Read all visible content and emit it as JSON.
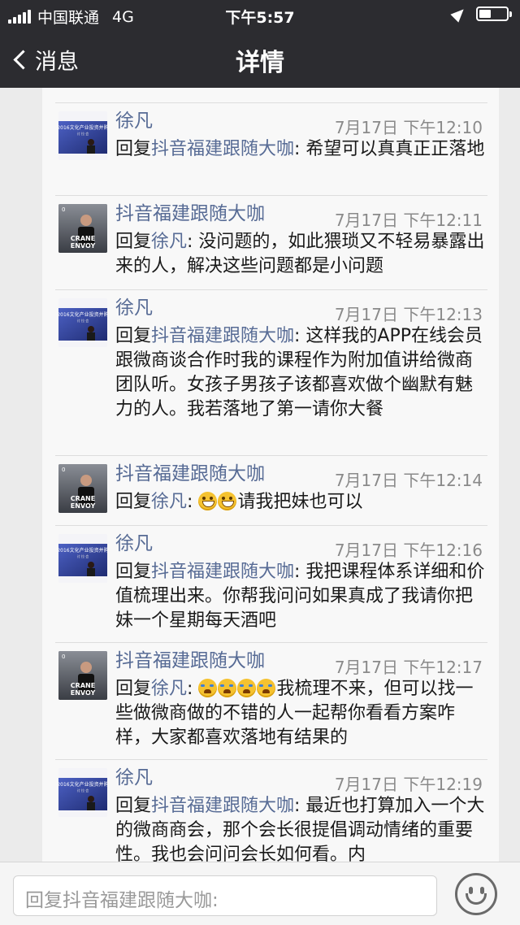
{
  "status": {
    "carrier": "中国联通",
    "network": "4G",
    "time": "下午5:57"
  },
  "nav": {
    "back_label": "消息",
    "title": "详情"
  },
  "comments": [
    {
      "author": "徐凡",
      "time": "7月17日 下午12:10",
      "reply_prefix": "回复",
      "reply_to": "抖音福建跟随大咖",
      "text": ": 希望可以真真正正落地"
    },
    {
      "author": "抖音福建跟随大咖",
      "time": "7月17日 下午12:11",
      "reply_prefix": "回复",
      "reply_to": "徐凡",
      "text": ": 没问题的，如此猥琐又不轻易暴露出来的人，解决这些问题都是小问题"
    },
    {
      "author": "徐凡",
      "time": "7月17日 下午12:13",
      "reply_prefix": "回复",
      "reply_to": "抖音福建跟随大咖",
      "text": ": 这样我的APP在线会员跟微商谈合作时我的课程作为附加值讲给微商团队听。女孩子男孩子该都喜欢做个幽默有魅力的人。我若落地了第一请你大餐"
    },
    {
      "author": "抖音福建跟随大咖",
      "time": "7月17日 下午12:14",
      "reply_prefix": "回复",
      "reply_to": "徐凡",
      "text_before": ": ",
      "text": "请我把妹也可以"
    },
    {
      "author": "徐凡",
      "time": "7月17日 下午12:16",
      "reply_prefix": "回复",
      "reply_to": "抖音福建跟随大咖",
      "text": ": 我把课程体系详细和价值梳理出来。你帮我问问如果真成了我请你把妹一个星期每天酒吧"
    },
    {
      "author": "抖音福建跟随大咖",
      "time": "7月17日 下午12:17",
      "reply_prefix": "回复",
      "reply_to": "徐凡",
      "text_before": ": ",
      "text": "我梳理不来，但可以找一些做微商做的不错的人一起帮你看看方案咋样，大家都喜欢落地有结果的"
    },
    {
      "author": "徐凡",
      "time": "7月17日 下午12:19",
      "reply_prefix": "回复",
      "reply_to": "抖音福建跟随大咖",
      "text": ": 最近也打算加入一个大的微商商会，那个会长很提倡调动情绪的重要性。我也会问问会长如何看。内"
    }
  ],
  "avatars": {
    "xufan_banner": "2016文化产业投资并购",
    "xufan_sub": "讨 拉 会",
    "crane_line1": "CRANE",
    "crane_line2": "ENVOY",
    "crane_corner": "0"
  },
  "input": {
    "placeholder": "回复抖音福建跟随大咖:"
  },
  "icons": {
    "emoji_button": "smiley-face-icon"
  }
}
